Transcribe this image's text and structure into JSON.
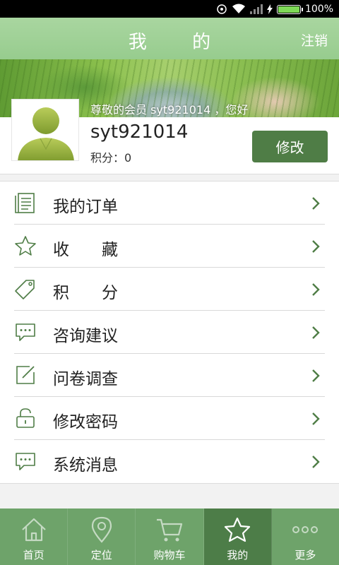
{
  "status_bar": {
    "battery_text": "100%",
    "battery_level": 1.0,
    "icons": [
      "signal-icon",
      "wifi-icon",
      "cell-signal-icon",
      "charging-icon"
    ]
  },
  "header": {
    "title": "我 的",
    "logout_label": "注销"
  },
  "banner": {
    "greeting": "尊敬的会员 syt921014 ，您好"
  },
  "profile": {
    "username": "syt921014",
    "points_text": "积分：0",
    "edit_label": "修改"
  },
  "menu": [
    {
      "label": "我的订单",
      "icon": "order-list-icon"
    },
    {
      "label": "收　　藏",
      "icon": "star-icon"
    },
    {
      "label": "积　　分",
      "icon": "tag-icon"
    },
    {
      "label": "咨询建议",
      "icon": "chat-icon"
    },
    {
      "label": "问卷调查",
      "icon": "edit-icon"
    },
    {
      "label": "修改密码",
      "icon": "lock-icon"
    },
    {
      "label": "系统消息",
      "icon": "message-icon"
    }
  ],
  "tabs": [
    {
      "label": "首页",
      "icon": "home-icon",
      "active": false
    },
    {
      "label": "定位",
      "icon": "location-icon",
      "active": false
    },
    {
      "label": "购物车",
      "icon": "cart-icon",
      "active": false
    },
    {
      "label": "我的",
      "icon": "star-icon",
      "active": true
    },
    {
      "label": "更多",
      "icon": "more-icon",
      "active": false
    }
  ],
  "colors": {
    "accent": "#4f7d46",
    "header": "#9fd197",
    "tabbar": "#6ea36a",
    "tab_active": "#4d7d48",
    "icon_stroke": "#4f7d46"
  }
}
